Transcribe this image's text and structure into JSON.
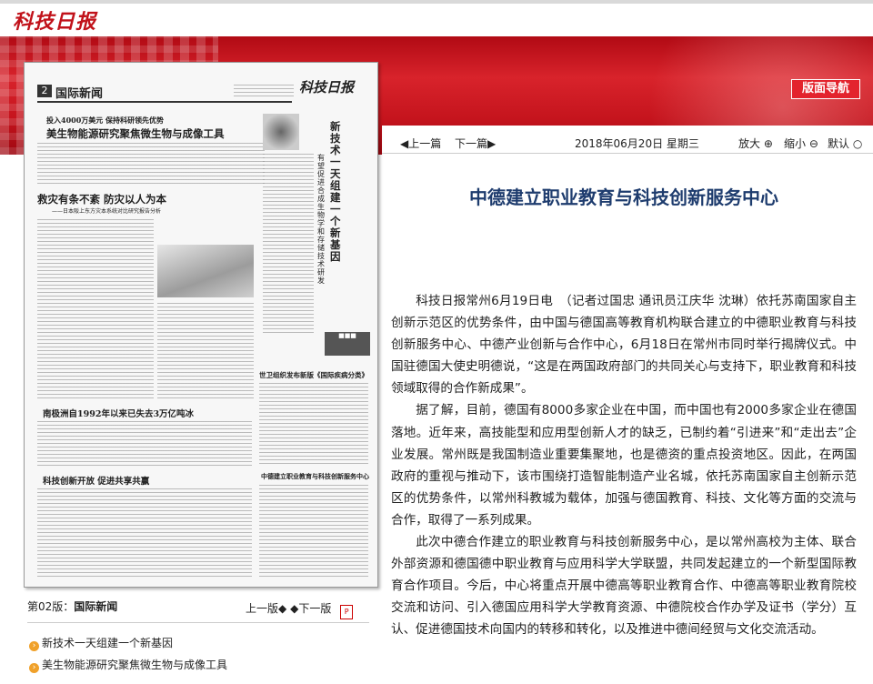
{
  "header": {
    "logo_text": "科技日报",
    "nav_button": "版面导航"
  },
  "paper_preview": {
    "page_label": "2",
    "section": "国际新闻",
    "masthead": "科技日报",
    "headline1_kicker": "投入4000万美元  保持科研领先优势",
    "headline1": "美生物能源研究聚焦微生物与成像工具",
    "headline2": "救灾有条不紊  防灾以人为本",
    "headline2_sub": "——日本阪上东方灾本系统对比研究报告分析",
    "vertical_title": "新技术一天组建一个新基因",
    "vertical_sub": "有望促进合成生物学和存储技术研发",
    "headline3": "南极洲自1992年以来已失去3万亿吨冰",
    "headline4": "科技创新开放  促进共享共赢",
    "headline5": "世卫组织发布新版《国际疾病分类》",
    "headline6": "中德建立职业教育与科技创新服务中心"
  },
  "left": {
    "page_caption_prefix": "第02版：",
    "page_caption_name": "国际新闻",
    "prev_page": "上一版",
    "next_page": "下一版",
    "article_links": [
      "新技术一天组建一个新基因",
      "美生物能源研究聚焦微生物与成像工具"
    ]
  },
  "toolbar": {
    "prev_article": "上一篇",
    "next_article": "下一篇",
    "date": "2018年06月20日 星期三",
    "zoom_in": "放大",
    "zoom_out": "缩小",
    "default": "默认"
  },
  "article": {
    "title": "中德建立职业教育与科技创新服务中心",
    "paragraphs": [
      "科技日报常州6月19日电　（记者过国忠 通讯员江庆华 沈琳）依托苏南国家自主创新示范区的优势条件，由中国与德国高等教育机构联合建立的中德职业教育与科技创新服务中心、中德产业创新与合作中心，6月18日在常州市同时举行揭牌仪式。中国驻德国大使史明德说，“这是在两国政府部门的共同关心与支持下，职业教育和科技领域取得的合作新成果”。",
      "据了解，目前，德国有8000多家企业在中国，而中国也有2000多家企业在德国落地。近年来，高技能型和应用型创新人才的缺乏，已制约着“引进来”和“走出去”企业发展。常州既是我国制造业重要集聚地，也是德资的重点投资地区。因此，在两国政府的重视与推动下，该市围绕打造智能制造产业名城，依托苏南国家自主创新示范区的优势条件，以常州科教城为载体，加强与德国教育、科技、文化等方面的交流与合作，取得了一系列成果。",
      "此次中德合作建立的职业教育与科技创新服务中心，是以常州高校为主体、联合外部资源和德国德中职业教育与应用科学大学联盟，共同发起建立的一个新型国际教育合作项目。今后，中心将重点开展中德高等职业教育合作、中德高等职业教育院校交流和访问、引入德国应用科学大学教育资源、中德院校合作办学及证书（学分）互认、促进德国技术向国内的转移和转化，以及推进中德间经贸与文化交流活动。"
    ]
  }
}
